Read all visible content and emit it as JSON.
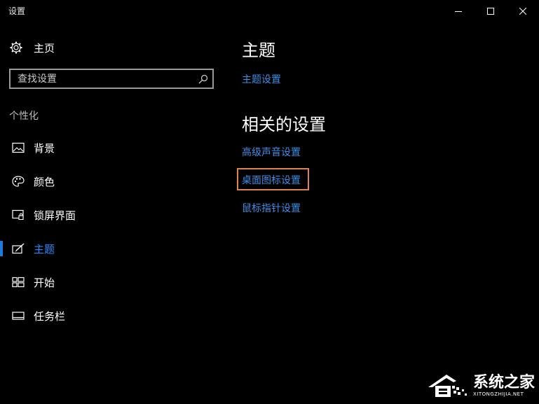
{
  "window": {
    "title": "设置"
  },
  "sidebar": {
    "home_label": "主页",
    "search": {
      "placeholder": "查找设置"
    },
    "section_title": "个性化",
    "items": [
      {
        "label": "背景",
        "icon": "image-icon",
        "active": false
      },
      {
        "label": "颜色",
        "icon": "palette-icon",
        "active": false
      },
      {
        "label": "锁屏界面",
        "icon": "lock-screen-icon",
        "active": false
      },
      {
        "label": "主题",
        "icon": "theme-brush-icon",
        "active": true
      },
      {
        "label": "开始",
        "icon": "start-grid-icon",
        "active": false
      },
      {
        "label": "任务栏",
        "icon": "taskbar-icon",
        "active": false
      }
    ]
  },
  "main": {
    "theme_heading": "主题",
    "theme_settings_link": "主题设置",
    "related_heading": "相关的设置",
    "related_links": [
      "高级声音设置",
      "桌面图标设置",
      "鼠标指针设置"
    ],
    "highlighted_link": "桌面图标设置"
  },
  "watermark": {
    "main": "系统之家",
    "sub": "XITONGZHIJIA.NET"
  },
  "colors": {
    "background": "#000000",
    "accent": "#1e8cff",
    "link": "#3c8ee6",
    "highlight_border": "#e0824a"
  }
}
